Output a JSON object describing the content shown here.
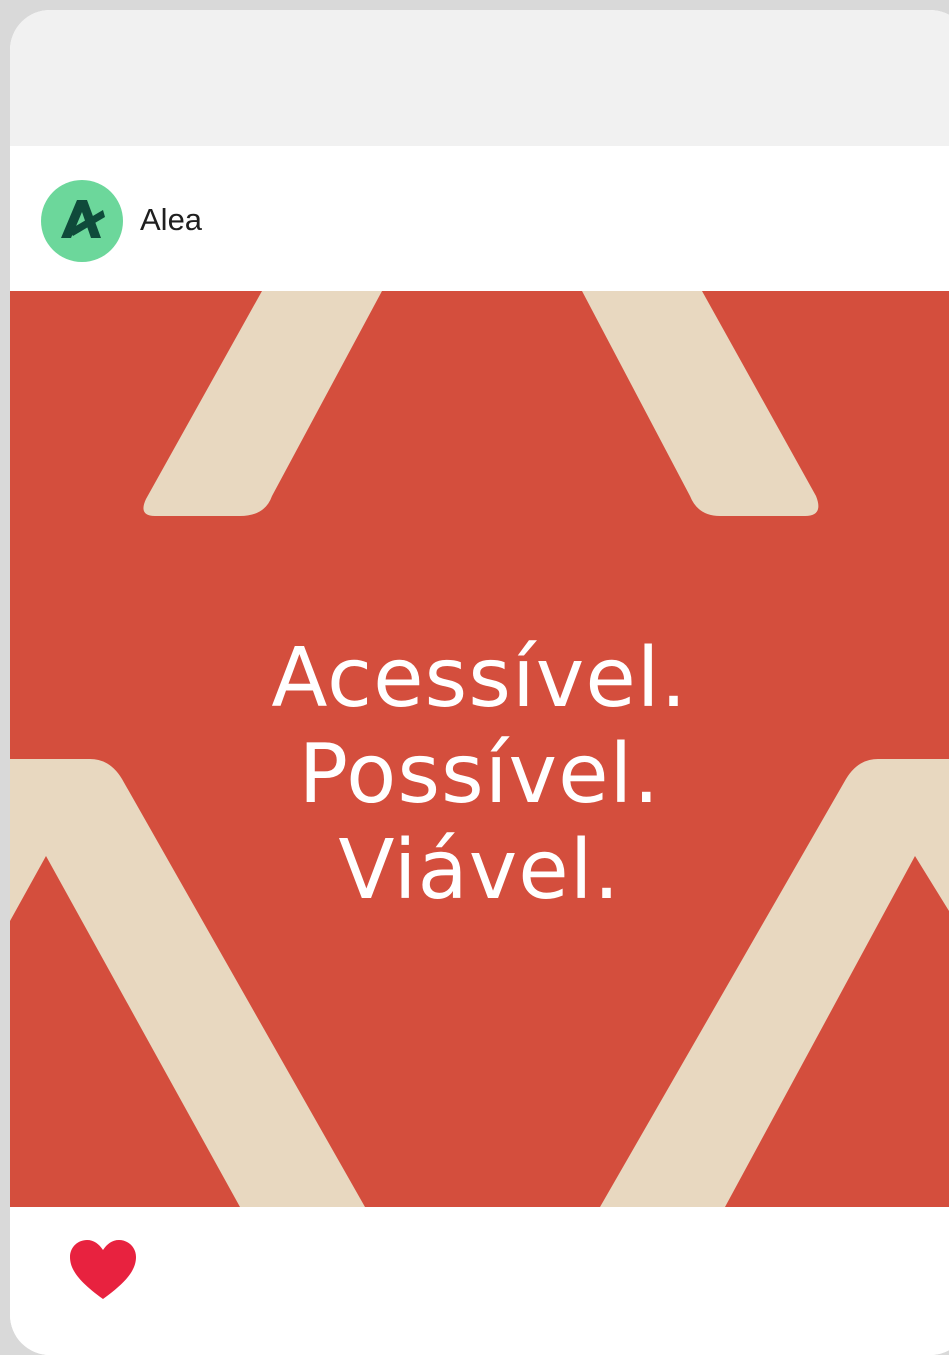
{
  "post": {
    "author": {
      "name": "Alea",
      "avatar_icon": "alea-logo-icon",
      "avatar_color": "#6cd79b",
      "avatar_mark_color": "#0f4a3a"
    },
    "image": {
      "background_color": "#d44e3d",
      "shape_color": "#e8d8c0",
      "headline_lines": [
        "Acessível.",
        "Possível.",
        "Viável."
      ]
    },
    "actions": {
      "like_icon": "heart-icon",
      "like_color": "#e8223f"
    }
  }
}
